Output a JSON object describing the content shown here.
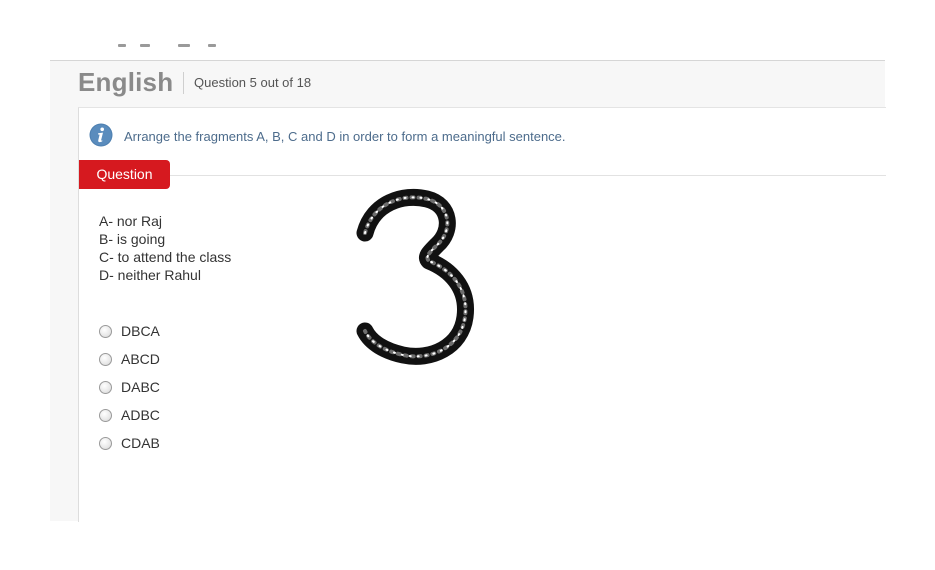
{
  "header": {
    "subject": "English",
    "progress": "Question 5 out of 18"
  },
  "instruction": {
    "icon": "info-icon",
    "text": "Arrange the fragments A, B, C and D in order to form a meaningful sentence."
  },
  "question": {
    "tab_label": "Question",
    "fragments": [
      "A- nor Raj",
      "B- is going",
      "C- to attend the class",
      "D- neither Rahul"
    ],
    "options": [
      {
        "label": "DBCA",
        "selected": false
      },
      {
        "label": "ABCD",
        "selected": false
      },
      {
        "label": "DABC",
        "selected": false
      },
      {
        "label": "ADBC",
        "selected": false
      },
      {
        "label": "CDAB",
        "selected": false
      }
    ]
  },
  "annotation": {
    "handwritten_text": "3",
    "color": "#111111"
  },
  "colors": {
    "accent_red": "#d6191f",
    "info_blue": "#4d7fb0",
    "instruction_text": "#4d6c8c",
    "title_gray": "#8a8a8a"
  }
}
